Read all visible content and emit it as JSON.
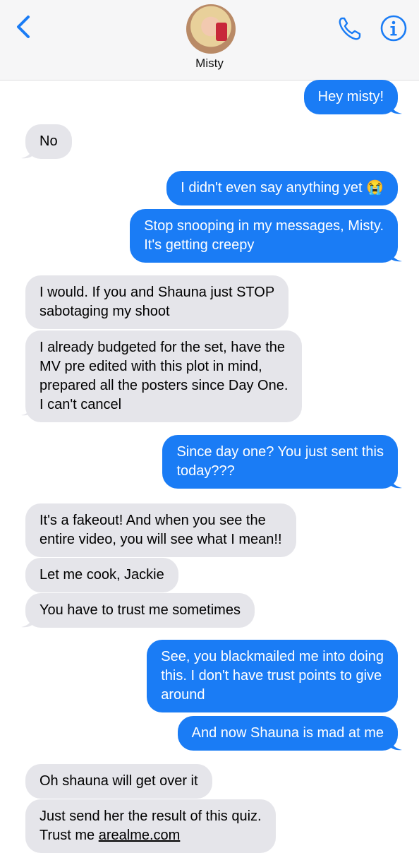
{
  "header": {
    "contact_name": "Misty",
    "icons": [
      "chevron-left-icon",
      "phone-icon",
      "info-icon"
    ],
    "accent_color": "#1a7cf5"
  },
  "messages": [
    {
      "dir": "out",
      "text": "Hey misty!"
    },
    {
      "dir": "in",
      "text": "No"
    },
    {
      "dir": "out",
      "text": "I didn't even say anything yet 😭"
    },
    {
      "dir": "out",
      "text": "Stop snooping in my messages, Misty.\nIt's getting creepy"
    },
    {
      "dir": "in",
      "text": "I would. If you and Shauna just STOP\nsabotaging my shoot"
    },
    {
      "dir": "in",
      "text": "I already budgeted for the set, have the\nMV pre edited with this plot in mind,\nprepared all the posters since Day One.\nI can't cancel"
    },
    {
      "dir": "out",
      "text": "Since day one? You just sent this\ntoday???"
    },
    {
      "dir": "in",
      "text": "It's a fakeout! And when you see the\nentire video, you will see what I mean!!"
    },
    {
      "dir": "in",
      "text": "Let me cook, Jackie"
    },
    {
      "dir": "in",
      "text": "You have to trust me sometimes"
    },
    {
      "dir": "out",
      "text": "See, you blackmailed me into doing\nthis. I don't have trust points to give\naround"
    },
    {
      "dir": "out",
      "text": "And now Shauna is mad at me"
    },
    {
      "dir": "in",
      "text": "Oh shauna will get over it"
    },
    {
      "dir": "in",
      "text": "Just send her the result of this quiz.\nTrust me ",
      "link": "arealme.com"
    }
  ],
  "colors": {
    "incoming_bubble": "#e5e5ea",
    "outgoing_bubble": "#1a7cf5"
  }
}
